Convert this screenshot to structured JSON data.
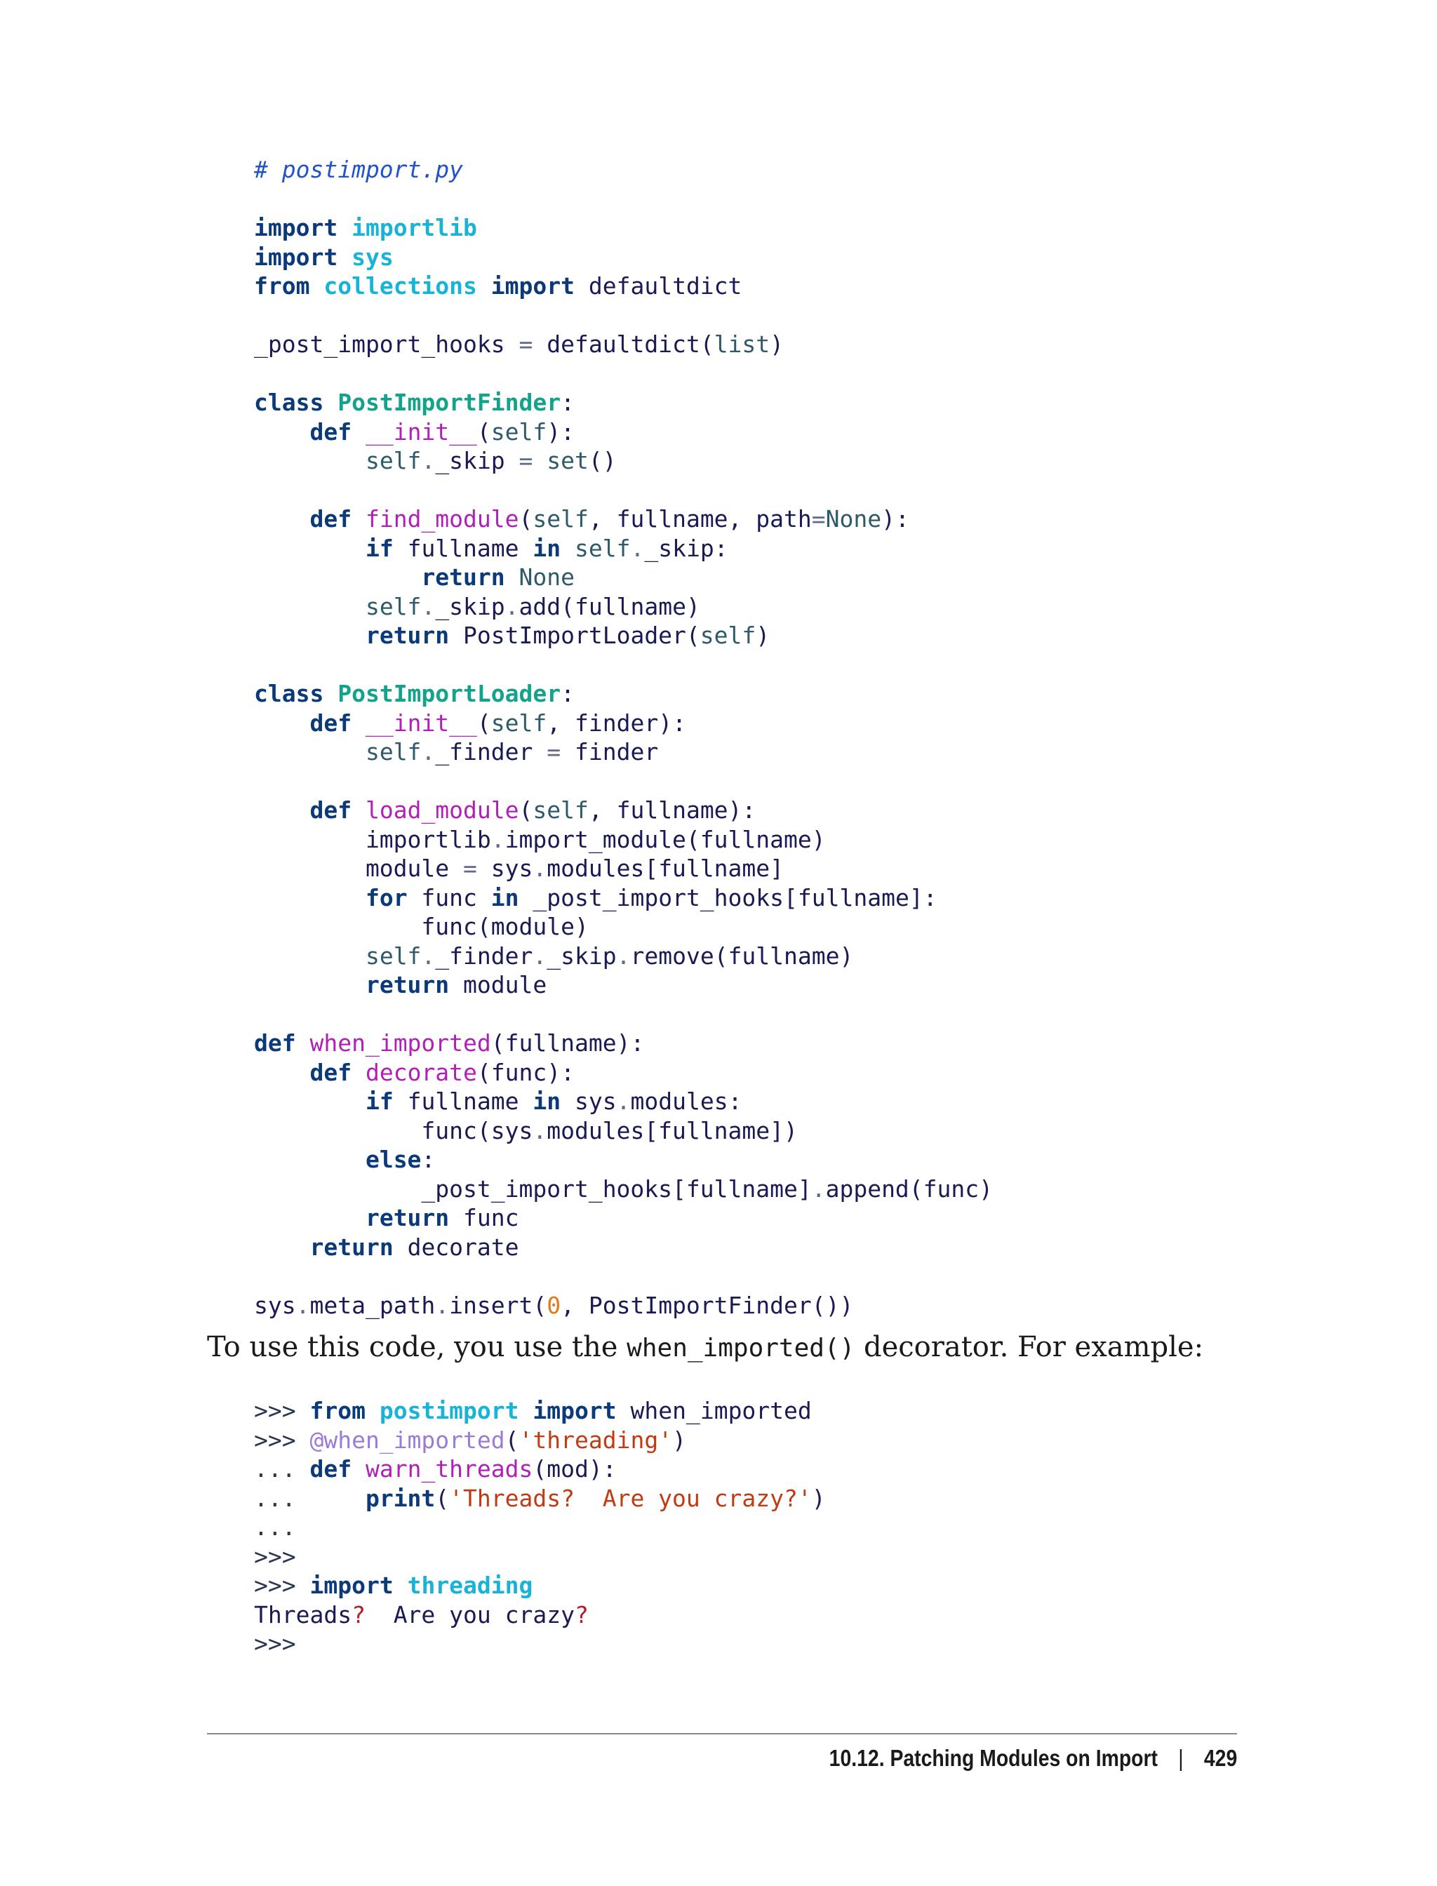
{
  "code_main": [
    "# postimport.py",
    "",
    "import importlib",
    "import sys",
    "from collections import defaultdict",
    "",
    "_post_import_hooks = defaultdict(list)",
    "",
    "class PostImportFinder:",
    "    def __init__(self):",
    "        self._skip = set()",
    "",
    "    def find_module(self, fullname, path=None):",
    "        if fullname in self._skip:",
    "            return None",
    "        self._skip.add(fullname)",
    "        return PostImportLoader(self)",
    "",
    "class PostImportLoader:",
    "    def __init__(self, finder):",
    "        self._finder = finder",
    "",
    "    def load_module(self, fullname):",
    "        importlib.import_module(fullname)",
    "        module = sys.modules[fullname]",
    "        for func in _post_import_hooks[fullname]:",
    "            func(module)",
    "        self._finder._skip.remove(fullname)",
    "        return module",
    "",
    "def when_imported(fullname):",
    "    def decorate(func):",
    "        if fullname in sys.modules:",
    "            func(sys.modules[fullname])",
    "        else:",
    "            _post_import_hooks[fullname].append(func)",
    "        return func",
    "    return decorate",
    "",
    "sys.meta_path.insert(0, PostImportFinder())"
  ],
  "prose": {
    "before": "To use this code, you use the ",
    "code": "when_imported()",
    "after": " decorator. For example:"
  },
  "code_example": [
    ">>> from postimport import when_imported",
    ">>> @when_imported('threading')",
    "... def warn_threads(mod):",
    "...     print('Threads?  Are you crazy?')",
    "...",
    ">>>",
    ">>> import threading",
    "Threads?  Are you crazy?",
    ">>>"
  ],
  "footer": {
    "section": "10.12. Patching Modules on Import",
    "separator": "|",
    "page_number": "429"
  }
}
